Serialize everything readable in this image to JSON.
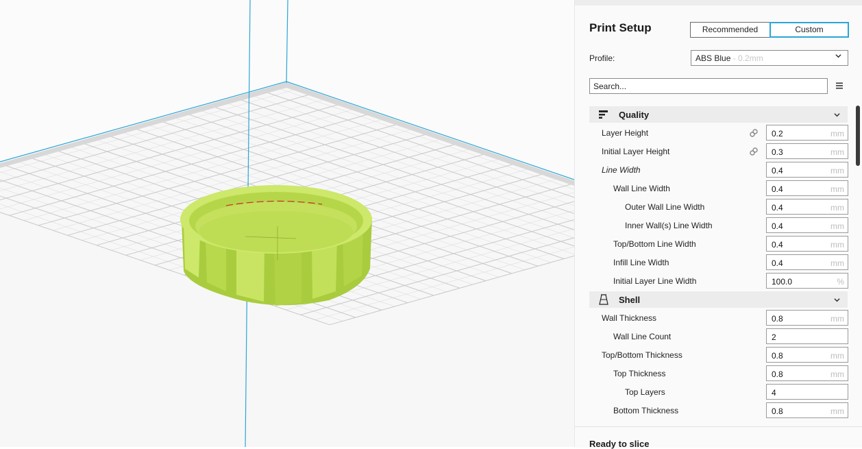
{
  "print_setup": {
    "title": "Print Setup",
    "mode_recommended": "Recommended",
    "mode_custom": "Custom",
    "active_mode": "Custom"
  },
  "profile": {
    "label": "Profile:",
    "name": "ABS Blue",
    "suffix": " - 0.2mm"
  },
  "search": {
    "placeholder": "Search..."
  },
  "icons": {
    "quality": "quality-icon",
    "shell": "shell-icon",
    "link": "link-icon",
    "menu": "menu-icon",
    "chevron": "chevron-down-icon"
  },
  "colors": {
    "accent": "#29a6d8",
    "model": "#c2e060",
    "build_plate": "#f7f7f7",
    "grid_line": "#c4c4c4",
    "axis_line": "#2aa5d6"
  },
  "quality": {
    "title": "Quality",
    "rows": [
      {
        "label": "Layer Height",
        "value": "0.2",
        "unit": "mm",
        "linked": true
      },
      {
        "label": "Initial Layer Height",
        "value": "0.3",
        "unit": "mm",
        "linked": true
      },
      {
        "label": "Line Width",
        "value": "0.4",
        "unit": "mm"
      },
      {
        "label": "Wall Line Width",
        "value": "0.4",
        "unit": "mm"
      },
      {
        "label": "Outer Wall Line Width",
        "value": "0.4",
        "unit": "mm"
      },
      {
        "label": "Inner Wall(s) Line Width",
        "value": "0.4",
        "unit": "mm"
      },
      {
        "label": "Top/Bottom Line Width",
        "value": "0.4",
        "unit": "mm"
      },
      {
        "label": "Infill Line Width",
        "value": "0.4",
        "unit": "mm"
      },
      {
        "label": "Initial Layer Line Width",
        "value": "100.0",
        "unit": "%"
      }
    ]
  },
  "shell": {
    "title": "Shell",
    "rows": [
      {
        "label": "Wall Thickness",
        "value": "0.8",
        "unit": "mm"
      },
      {
        "label": "Wall Line Count",
        "value": "2",
        "unit": ""
      },
      {
        "label": "Top/Bottom Thickness",
        "value": "0.8",
        "unit": "mm"
      },
      {
        "label": "Top Thickness",
        "value": "0.8",
        "unit": "mm"
      },
      {
        "label": "Top Layers",
        "value": "4",
        "unit": ""
      },
      {
        "label": "Bottom Thickness",
        "value": "0.8",
        "unit": "mm"
      }
    ]
  },
  "status": {
    "text": "Ready to slice"
  }
}
